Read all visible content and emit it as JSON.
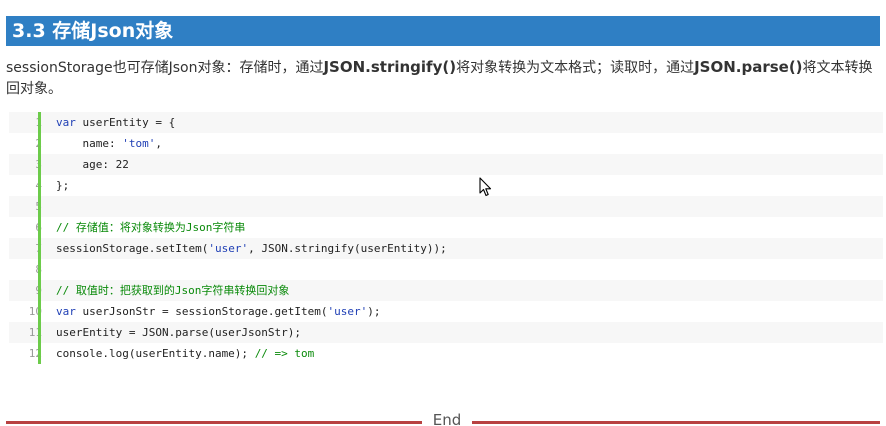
{
  "section": {
    "heading": "3.3 存储Json对象"
  },
  "description": {
    "part1": "sessionStorage也可存储Json对象：存储时，通过",
    "api1": "JSON.stringify()",
    "part2": "将对象转换为文本格式；读取时，通过",
    "api2": "JSON.parse()",
    "part3": "将文本转换回对象。"
  },
  "code": {
    "lines": [
      {
        "num": "1",
        "segments": [
          {
            "cls": "kw",
            "text": "var"
          },
          {
            "cls": "",
            "text": " userEntity = {"
          }
        ]
      },
      {
        "num": "2",
        "segments": [
          {
            "cls": "",
            "text": "    name: "
          },
          {
            "cls": "str",
            "text": "'tom'"
          },
          {
            "cls": "",
            "text": ","
          }
        ]
      },
      {
        "num": "3",
        "segments": [
          {
            "cls": "",
            "text": "    age: 22"
          }
        ]
      },
      {
        "num": "4",
        "segments": [
          {
            "cls": "",
            "text": "};"
          }
        ]
      },
      {
        "num": "5",
        "segments": []
      },
      {
        "num": "6",
        "segments": [
          {
            "cls": "cm",
            "text": "// 存储值：将对象转换为Json字符串"
          }
        ]
      },
      {
        "num": "7",
        "segments": [
          {
            "cls": "",
            "text": "sessionStorage.setItem("
          },
          {
            "cls": "str",
            "text": "'user'"
          },
          {
            "cls": "",
            "text": ", JSON.stringify(userEntity));"
          }
        ]
      },
      {
        "num": "8",
        "segments": []
      },
      {
        "num": "9",
        "segments": [
          {
            "cls": "cm",
            "text": "// 取值时：把获取到的Json字符串转换回对象"
          }
        ]
      },
      {
        "num": "10",
        "segments": [
          {
            "cls": "kw",
            "text": "var"
          },
          {
            "cls": "",
            "text": " userJsonStr = sessionStorage.getItem("
          },
          {
            "cls": "str",
            "text": "'user'"
          },
          {
            "cls": "",
            "text": ");"
          }
        ]
      },
      {
        "num": "11",
        "segments": [
          {
            "cls": "",
            "text": "userEntity = JSON.parse(userJsonStr);"
          }
        ]
      },
      {
        "num": "12",
        "segments": [
          {
            "cls": "",
            "text": "console.log(userEntity.name); "
          },
          {
            "cls": "cm",
            "text": "// => tom"
          }
        ]
      }
    ]
  },
  "footer": {
    "end_label": "End"
  },
  "colors": {
    "heading_bg": "#2f7fc4",
    "gutter_accent": "#6ccb4a",
    "keyword": "#1f3fb5",
    "comment": "#0a8a0a",
    "end_rule": "#b84141"
  },
  "icons": {
    "cursor": "mouse-pointer-icon"
  }
}
